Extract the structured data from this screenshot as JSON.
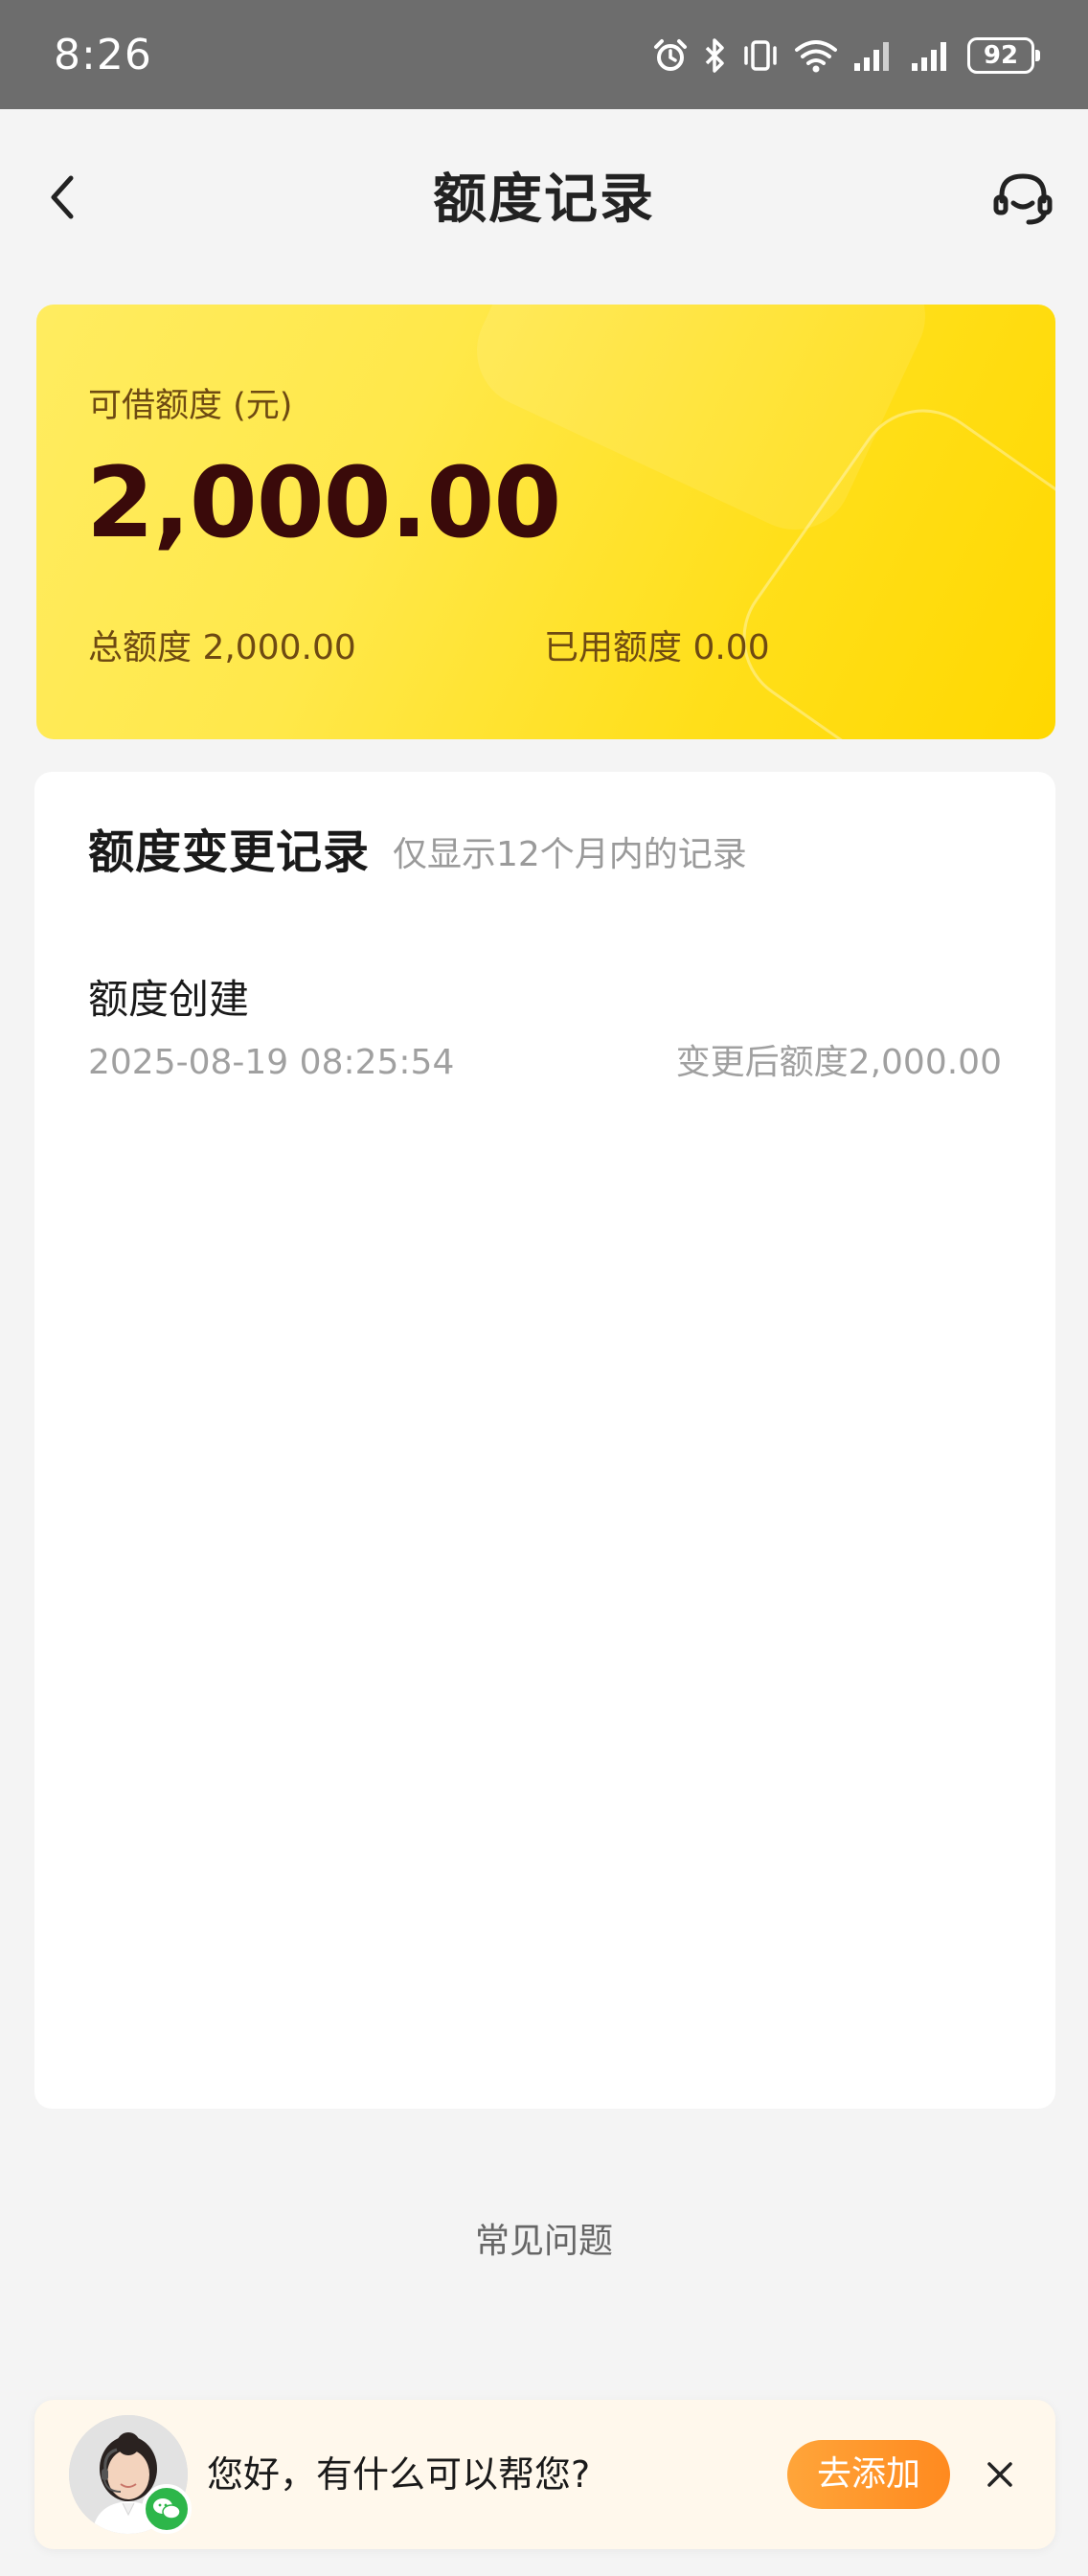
{
  "status_bar": {
    "time": "8:26",
    "battery": "92",
    "icons": [
      "alarm-icon",
      "bluetooth-icon",
      "vibrate-icon",
      "wifi-icon",
      "signal-icon",
      "signal-icon"
    ]
  },
  "header": {
    "title": "额度记录",
    "back_icon": "back-arrow-icon",
    "service_icon": "headset-icon"
  },
  "quota_card": {
    "available_label": "可借额度 (元)",
    "available_amount": "2,000.00",
    "total_label": "总额度 2,000.00",
    "used_label": "已用额度 0.00",
    "colors": {
      "gradient_start": "#ffec60",
      "gradient_end": "#ffd800",
      "amount_color": "#3a0a0a"
    }
  },
  "records": {
    "title": "额度变更记录",
    "hint": "仅显示12个月内的记录",
    "items": [
      {
        "type": "额度创建",
        "time": "2025-08-19 08:25:54",
        "after": "变更后额度2,000.00"
      }
    ]
  },
  "faq": {
    "label": "常见问题"
  },
  "assist_banner": {
    "text": "您好，有什么可以帮您?",
    "add_label": "去添加",
    "accent": "#ff9a2e",
    "badge_color": "#2db64a"
  }
}
